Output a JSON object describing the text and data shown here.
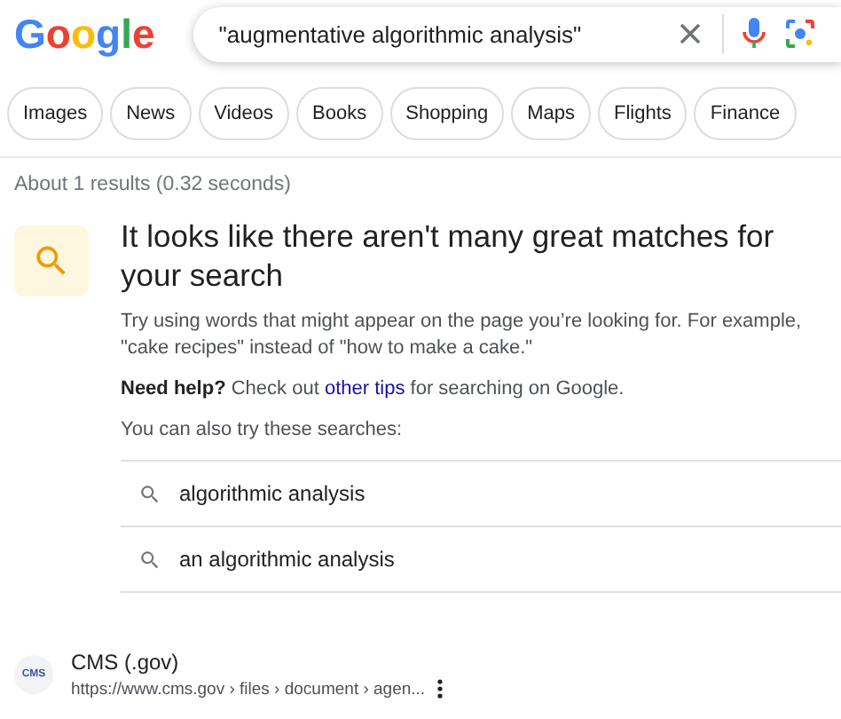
{
  "header": {
    "logo": "Google",
    "search": {
      "value": "\"augmentative algorithmic analysis\""
    }
  },
  "filters": [
    {
      "label": "Images"
    },
    {
      "label": "News"
    },
    {
      "label": "Videos"
    },
    {
      "label": "Books"
    },
    {
      "label": "Shopping"
    },
    {
      "label": "Maps"
    },
    {
      "label": "Flights"
    },
    {
      "label": "Finance"
    }
  ],
  "stats": "About 1 results (0.32 seconds)",
  "notice": {
    "heading": "It looks like there aren't many great matches for your search",
    "body": "Try using words that might appear on the page you’re looking for. For example, \"cake recipes\" instead of \"how to make a cake.\"",
    "help": {
      "lead": "Need help?",
      "before": "Check out",
      "link": "other tips",
      "after": "for searching on Google."
    },
    "suggest_label": "You can also try these searches:",
    "suggestions": [
      "algorithmic analysis",
      "an algorithmic analysis"
    ]
  },
  "result": {
    "favicon": "CMS",
    "site": "CMS (.gov)",
    "url": "https://www.cms.gov › files › document › agen..."
  }
}
